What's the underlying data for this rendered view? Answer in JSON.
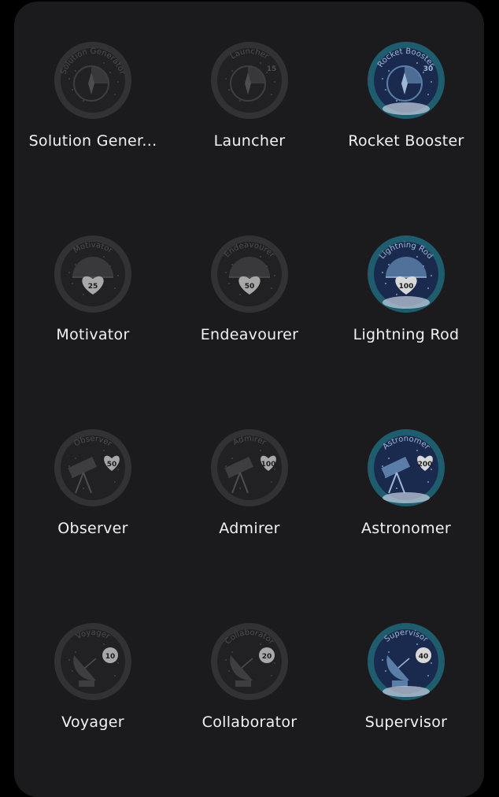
{
  "badges": [
    {
      "label": "Solution Gener...",
      "ring_text": "Solution Generator",
      "number": "",
      "icon": "compass",
      "achieved": false
    },
    {
      "label": "Launcher",
      "ring_text": "Launcher",
      "number": "15",
      "icon": "compass",
      "achieved": false
    },
    {
      "label": "Rocket Booster",
      "ring_text": "Rocket Booster",
      "number": "30",
      "icon": "compass",
      "achieved": true
    },
    {
      "label": "Motivator",
      "ring_text": "Motivator",
      "number": "25",
      "icon": "heart-meter",
      "achieved": false
    },
    {
      "label": "Endeavourer",
      "ring_text": "Endeavourer",
      "number": "50",
      "icon": "heart-meter",
      "achieved": false
    },
    {
      "label": "Lightning Rod",
      "ring_text": "Lightning Rod",
      "number": "100",
      "icon": "heart-meter",
      "achieved": true
    },
    {
      "label": "Observer",
      "ring_text": "Observer",
      "number": "50",
      "icon": "telescope",
      "achieved": false
    },
    {
      "label": "Admirer",
      "ring_text": "Admirer",
      "number": "100",
      "icon": "telescope",
      "achieved": false
    },
    {
      "label": "Astronomer",
      "ring_text": "Astronomer",
      "number": "200",
      "icon": "telescope",
      "achieved": true
    },
    {
      "label": "Voyager",
      "ring_text": "Voyager",
      "number": "10",
      "icon": "satellite-dish",
      "achieved": false
    },
    {
      "label": "Collaborator",
      "ring_text": "Collaborator",
      "number": "20",
      "icon": "satellite-dish",
      "achieved": false
    },
    {
      "label": "Supervisor",
      "ring_text": "Supervisor",
      "number": "40",
      "icon": "satellite-dish",
      "achieved": true
    }
  ],
  "colors": {
    "panel": "#1b1b1d",
    "locked_ring": "#3a3a3c",
    "locked_fill": "#232326",
    "achieved_ring": "#1f5d6e",
    "achieved_fill": "#1a2a4e"
  }
}
